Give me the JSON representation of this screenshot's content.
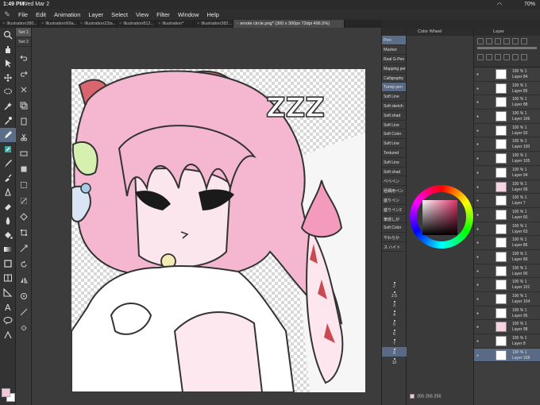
{
  "status": {
    "time": "1:49 PM",
    "date": "Wed Mar 2",
    "battery": "70%",
    "wifi": "wifi-icon"
  },
  "menu": [
    "File",
    "Edit",
    "Animation",
    "Layer",
    "Select",
    "View",
    "Filter",
    "Window",
    "Help"
  ],
  "tabs": [
    {
      "label": "Illustration380..."
    },
    {
      "label": "Illustration90la..."
    },
    {
      "label": "Illustration22la..."
    },
    {
      "label": "Illustration812..."
    },
    {
      "label": "Illustration*"
    },
    {
      "label": "Illustration382..."
    },
    {
      "label": "emote circle.png* (300 x 300px 72dpi 496.5%)"
    }
  ],
  "subtool_sets": [
    "Set 1",
    "Set 2"
  ],
  "brush_panel": {
    "tabs": [
      "Pen",
      "Marker"
    ],
    "items": [
      "Real G-Pen",
      "Mapping pen",
      "Calligraphy",
      "Turnip pen",
      "Soft Line",
      "Soft sketch",
      "Soft shad",
      "Soft Line",
      "Soft Color",
      "Soft Line",
      "Textured",
      "Soft Line",
      "Soft shad",
      "ベベペン",
      "極細用ペン",
      "盛りペン",
      "盛りペン2",
      "筆感しが",
      "Soft Color",
      "やわらか",
      "ス ハイト"
    ],
    "sizes": [
      "2",
      "2.5",
      "3",
      "4",
      "5",
      "6",
      "7",
      "8",
      "10"
    ]
  },
  "color_panel": {
    "title": "Color Wheel",
    "rgb": "255 255 255",
    "fg_color": "#f3c6dc",
    "bg_color": "#ffffff"
  },
  "layer_panel": {
    "title": "Layer",
    "layers": [
      {
        "opacity": "100 % 1",
        "name": "Layer 84"
      },
      {
        "opacity": "100 % 1",
        "name": "Layer 85"
      },
      {
        "opacity": "100 % 1",
        "name": "Layer 88"
      },
      {
        "opacity": "100 % 1",
        "name": "Layer 106"
      },
      {
        "opacity": "100 % 1",
        "name": "Layer 93"
      },
      {
        "opacity": "100 % 1",
        "name": "Layer 100"
      },
      {
        "opacity": "100 % 1",
        "name": "Layer 105"
      },
      {
        "opacity": "100 % 1",
        "name": "Layer 94"
      },
      {
        "opacity": "100 % 1",
        "name": "Layer 99"
      },
      {
        "opacity": "100 % 1",
        "name": "Layer 7"
      },
      {
        "opacity": "100 % 1",
        "name": "Layer 60"
      },
      {
        "opacity": "100 % 1",
        "name": "Layer 63"
      },
      {
        "opacity": "100 % 1",
        "name": "Layer 86"
      },
      {
        "opacity": "100 % 1",
        "name": "Layer 89"
      },
      {
        "opacity": "100 % 1",
        "name": "Layer 90"
      },
      {
        "opacity": "100 % 1",
        "name": "Layer 101"
      },
      {
        "opacity": "100 % 1",
        "name": "Layer 104"
      },
      {
        "opacity": "100 % 1",
        "name": "Layer 95"
      },
      {
        "opacity": "100 % 1",
        "name": "Layer 98"
      },
      {
        "opacity": "100 % 1",
        "name": "Layer 8"
      },
      {
        "opacity": "100 % 1",
        "name": "Layer 108"
      }
    ]
  },
  "canvas": {
    "zzz_text": "ZZZ"
  }
}
